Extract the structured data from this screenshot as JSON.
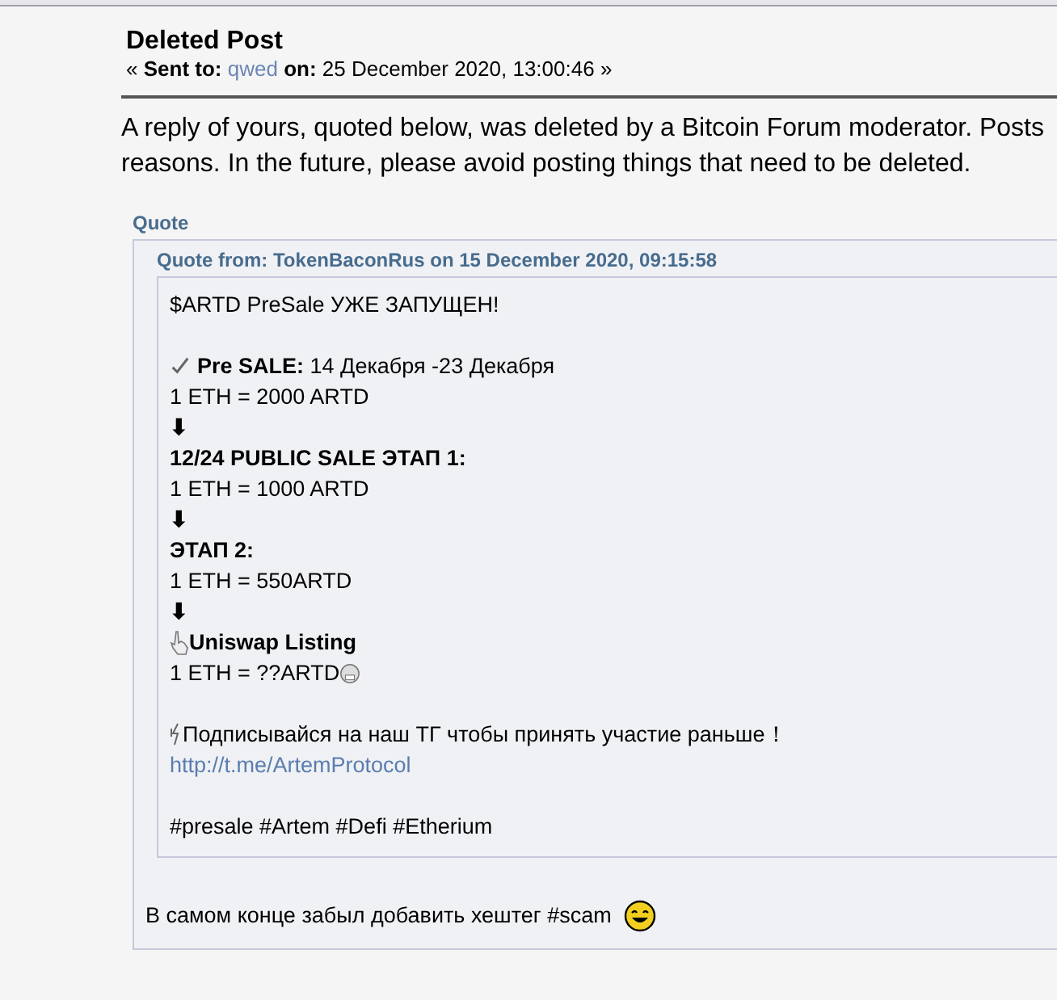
{
  "message": {
    "title": "Deleted Post",
    "sent_open": "«",
    "sent_label": "Sent to:",
    "recipient": "qwed",
    "date_label": "on:",
    "date": "25 December 2020, 13:00:46",
    "sent_close": "»"
  },
  "notice_lines": [
    "A reply of yours, quoted below, was deleted by a Bitcoin Forum moderator. Posts",
    "reasons. In the future, please avoid posting things that need to be deleted."
  ],
  "quote": {
    "header": "Quote",
    "from": "Quote from: TokenBaconRus on 15 December 2020, 09:15:58",
    "lines": [
      {
        "kind": "text",
        "text": "$ARTD PreSale УЖЕ ЗАПУЩЕН!"
      },
      {
        "kind": "blank"
      },
      {
        "kind": "check",
        "text": "**Pre SALE:** 14 Декабря -23 Декабря"
      },
      {
        "kind": "text",
        "text": "1 ETH = 2000 ARTD"
      },
      {
        "kind": "bold",
        "text": "⬇"
      },
      {
        "kind": "bold",
        "text": "12/24 PUBLIC SALE ЭТАП 1:"
      },
      {
        "kind": "text",
        "text": "1 ETH = 1000 ARTD"
      },
      {
        "kind": "bold",
        "text": "⬇"
      },
      {
        "kind": "bold",
        "text": "ЭТАП 2:"
      },
      {
        "kind": "text",
        "text": "1 ETH = 550ARTD"
      },
      {
        "kind": "bold",
        "text": "⬇"
      },
      {
        "kind": "hand",
        "text": "Uniswap Listing"
      },
      {
        "kind": "grin",
        "text": "1 ETH = ??ARTD"
      },
      {
        "kind": "blank"
      },
      {
        "kind": "bolt",
        "text": "Подписывайся на наш ТГ чтобы принять участие раньше！"
      },
      {
        "kind": "link",
        "text": "http://t.me/ArtemProtocol"
      },
      {
        "kind": "blank"
      },
      {
        "kind": "text",
        "text": "#presale #Artem #Defi #Etherium"
      }
    ]
  },
  "reply": {
    "text": "В самом конце забыл добавить хештег #scam"
  }
}
